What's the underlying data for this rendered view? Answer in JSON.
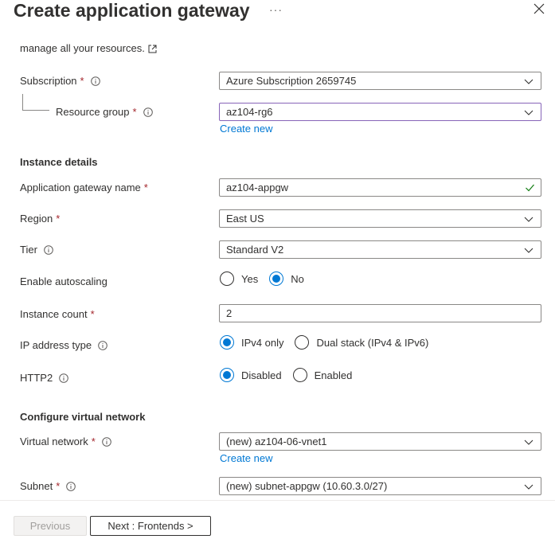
{
  "header": {
    "title": "Create application gateway",
    "more_icon": "more-icon",
    "close_icon": "close-icon"
  },
  "intro_text": "manage all your resources.",
  "subscription": {
    "label": "Subscription",
    "value": "Azure Subscription 2659745"
  },
  "resource_group": {
    "label": "Resource group",
    "value": "az104-rg6",
    "create_new": "Create new"
  },
  "instance_details": {
    "heading": "Instance details",
    "gateway_name": {
      "label": "Application gateway name",
      "value": "az104-appgw"
    },
    "region": {
      "label": "Region",
      "value": "East US"
    },
    "tier": {
      "label": "Tier",
      "value": "Standard V2"
    },
    "autoscaling": {
      "label": "Enable autoscaling",
      "options": [
        "Yes",
        "No"
      ],
      "selected": "No"
    },
    "instance_count": {
      "label": "Instance count",
      "value": "2"
    },
    "ip_type": {
      "label": "IP address type",
      "options": [
        "IPv4 only",
        "Dual stack (IPv4 & IPv6)"
      ],
      "selected": "IPv4 only"
    },
    "http2": {
      "label": "HTTP2",
      "options": [
        "Disabled",
        "Enabled"
      ],
      "selected": "Disabled"
    }
  },
  "vnet": {
    "heading": "Configure virtual network",
    "virtual_network": {
      "label": "Virtual network",
      "value": "(new) az104-06-vnet1",
      "create_new": "Create new"
    },
    "subnet": {
      "label": "Subnet",
      "value": "(new) subnet-appgw (10.60.3.0/27)"
    }
  },
  "footer": {
    "previous": "Previous",
    "next": "Next : Frontends >"
  },
  "required_marker": "*",
  "colors": {
    "accent": "#0078d4",
    "required": "#a4262c",
    "focus_border": "#8764b8",
    "valid": "#107c10"
  }
}
